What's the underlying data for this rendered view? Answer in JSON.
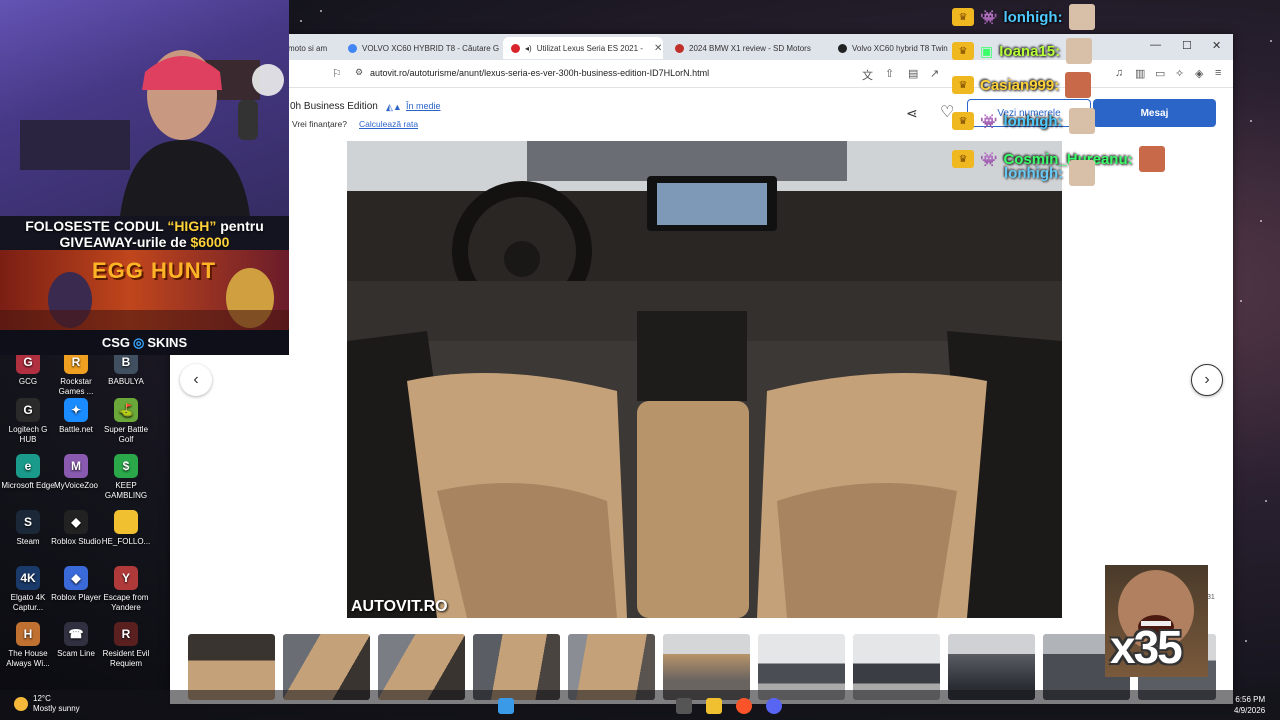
{
  "browser": {
    "tabs": [
      {
        "label": "moto si am"
      },
      {
        "label": "VOLVO XC60 HYBRID T8 - Căutare G"
      },
      {
        "label": "Utilizat Lexus Seria ES 2021 -",
        "active": true
      },
      {
        "label": "2024 BMW X1 review - SD Motors"
      },
      {
        "label": "Volvo XC60 hybrid T8 Twin E"
      }
    ],
    "url": "autovit.ro/autoturisme/anunt/lexus-seria-es-ver-300h-business-edition-ID7HLorN.html"
  },
  "listing": {
    "title_fragment": "0h Business Edition",
    "price_badge": "În medie",
    "finance_question": "Vrei finanțare?",
    "finance_link": "Calculează rata",
    "phone_button": "Vezi numerele",
    "message_button": "Mesaj"
  },
  "gallery": {
    "watermark": "AUTOVIT.RO",
    "counter": "/31",
    "thumbnail_count": 11
  },
  "stream": {
    "promo_line1_a": "FOLOSESTE CODUL ",
    "promo_code": "“HIGH”",
    "promo_line1_b": " pentru",
    "promo_line2_a": "GIVEAWAY-urile de ",
    "promo_amount": "$6000",
    "banner_title": "EGG HUNT",
    "sponsor": "CSG",
    "sponsor_b": "SKINS",
    "chat": [
      {
        "user": "lonhigh:",
        "color": "#4fc8ff"
      },
      {
        "user": "Ioana15:",
        "color": "#b8ff3a"
      },
      {
        "user": "Casian999:",
        "color": "#ffd23a"
      },
      {
        "user": "lonhigh:",
        "color": "#4fc8ff"
      },
      {
        "user": "Cosmin_Hureanu:",
        "color": "#3aff6a"
      },
      {
        "user": "lonhigh:",
        "color": "#4fc8ff"
      }
    ],
    "multiplier": "x35"
  },
  "desktop": {
    "icons": [
      {
        "label": "GCG"
      },
      {
        "label": "Rockstar Games ..."
      },
      {
        "label": "BABULYA"
      },
      {
        "label": "Logitech G HUB"
      },
      {
        "label": "Battle.net"
      },
      {
        "label": "Super Battle Golf"
      },
      {
        "label": "Microsoft Edge"
      },
      {
        "label": "MyVoiceZoo"
      },
      {
        "label": "KEEP GAMBLING"
      },
      {
        "label": "Steam"
      },
      {
        "label": "Roblox Studio"
      },
      {
        "label": "HE_FOLLO..."
      },
      {
        "label": "Elgato 4K Captur..."
      },
      {
        "label": "Roblox Player"
      },
      {
        "label": "Escape from Yandere"
      },
      {
        "label": "The House Always Wi..."
      },
      {
        "label": "Scam Line"
      },
      {
        "label": "Resident Evil Requiem"
      }
    ]
  },
  "taskbar": {
    "temperature": "12°C",
    "weather": "Mostly sunny",
    "time": "6:56 PM",
    "date": "4/9/2026"
  }
}
